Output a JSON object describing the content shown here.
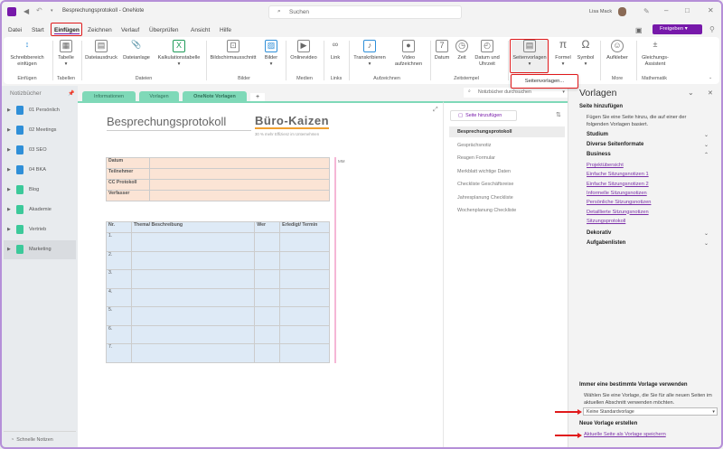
{
  "titlebar": {
    "title": "Besprechungsprotokoll - OneNote",
    "search_placeholder": "Suchen",
    "user": "Lisa Mack",
    "share": "Freigeben"
  },
  "menu": [
    "Datei",
    "Start",
    "Einfügen",
    "Zeichnen",
    "Verlauf",
    "Überprüfen",
    "Ansicht",
    "Hilfe"
  ],
  "ribbon": {
    "buttons": [
      "Schreibbereich einfügen",
      "Tabelle",
      "Dateiausdruck",
      "Dateianlage",
      "Kalkulationstabelle",
      "Bildschirmausschnitt",
      "Bilder",
      "Onlinevideo",
      "Link",
      "Transkribieren",
      "Video aufzeichnen",
      "Datum",
      "Zeit",
      "Datum und Uhrzeit",
      "Seitenvorlagen",
      "Formel",
      "Symbol",
      "Aufkleber",
      "Gleichungs-Assistent"
    ],
    "groups": [
      "Einfügen",
      "Tabellen",
      "Dateien",
      "Bilder",
      "Medien",
      "Links",
      "Aufzeichnen",
      "Zeitstempel",
      "More",
      "Mathematik"
    ],
    "dropdown_item": "Seitenvorlagen..."
  },
  "notebooks": {
    "header": "Notizbücher",
    "items": [
      {
        "label": "01 Persönlich",
        "color": "#2f8fd8"
      },
      {
        "label": "02 Meetings",
        "color": "#2f8fd8"
      },
      {
        "label": "03 SEO",
        "color": "#2f8fd8"
      },
      {
        "label": "04 BKA",
        "color": "#2f8fd8"
      },
      {
        "label": "Blog",
        "color": "#3cc99a"
      },
      {
        "label": "Akademie",
        "color": "#3cc99a"
      },
      {
        "label": "Vertrieb",
        "color": "#3cc99a"
      },
      {
        "label": "Marketing",
        "color": "#3cc99a"
      }
    ],
    "quick_notes": "Schnelle Notizen"
  },
  "sections": [
    "Informationen",
    "Vorlagen",
    "OneNote Vorlagen"
  ],
  "notebook_search": "Notizbücher durchsuchen",
  "page": {
    "title": "Besprechungsprotokoll",
    "logo": "Büro-Kaizen",
    "logo_sub": "30 % mehr Effizienz im Unternehmen",
    "author_tag": "MM",
    "info_rows": [
      "Datum",
      "Teilnehmer",
      "CC Protokoll",
      "Verfasser"
    ],
    "task_headers": [
      "Nr.",
      "Thema/ Beschreibung",
      "Wer",
      "Erledigt/ Termin"
    ],
    "task_rows": [
      "1.",
      "2.",
      "3.",
      "4.",
      "5.",
      "6.",
      "7."
    ]
  },
  "pages": {
    "add": "Seite hinzufügen",
    "items": [
      "Besprechungsprotokoll",
      "Gesprächsnotiz",
      "Reagen Formular",
      "Merkblatt wichtige Daten",
      "Checkliste Geschäftsreise",
      "Jahresplanung Checkliste",
      "Wochenplanung Checkliste"
    ]
  },
  "templates": {
    "title": "Vorlagen",
    "add_page": "Seite hinzufügen",
    "intro": "Fügen Sie eine Seite hinzu, die auf einer der folgenden Vorlagen basiert.",
    "categories": {
      "studium": "Studium",
      "diverse": "Diverse Seitenformate",
      "business": "Business",
      "dekorativ": "Dekorativ",
      "aufgaben": "Aufgabenlisten"
    },
    "business_items": [
      "Projektübersicht",
      "Einfache Sitzungsnotizen 1",
      "Einfache Sitzungsnotizen 2",
      "Informelle Sitzungsnotizen",
      "Persönliche Sitzungsnotizen",
      "Detaillierte Sitzungsnotizen",
      "Sitzungsprotokoll"
    ],
    "always_title": "Immer eine bestimmte Vorlage verwenden",
    "always_desc": "Wählen Sie eine Vorlage, die Sie für alle neuen Seiten im aktuellen Abschnitt verwenden möchten.",
    "default_select": "Keine Standardvorlage",
    "new_title": "Neue Vorlage erstellen",
    "save_link": "Aktuelle Seite als Vorlage speichern"
  },
  "colors": {
    "accent": "#7719aa",
    "highlight": "#e0191b",
    "section": "#7fd9b8"
  }
}
